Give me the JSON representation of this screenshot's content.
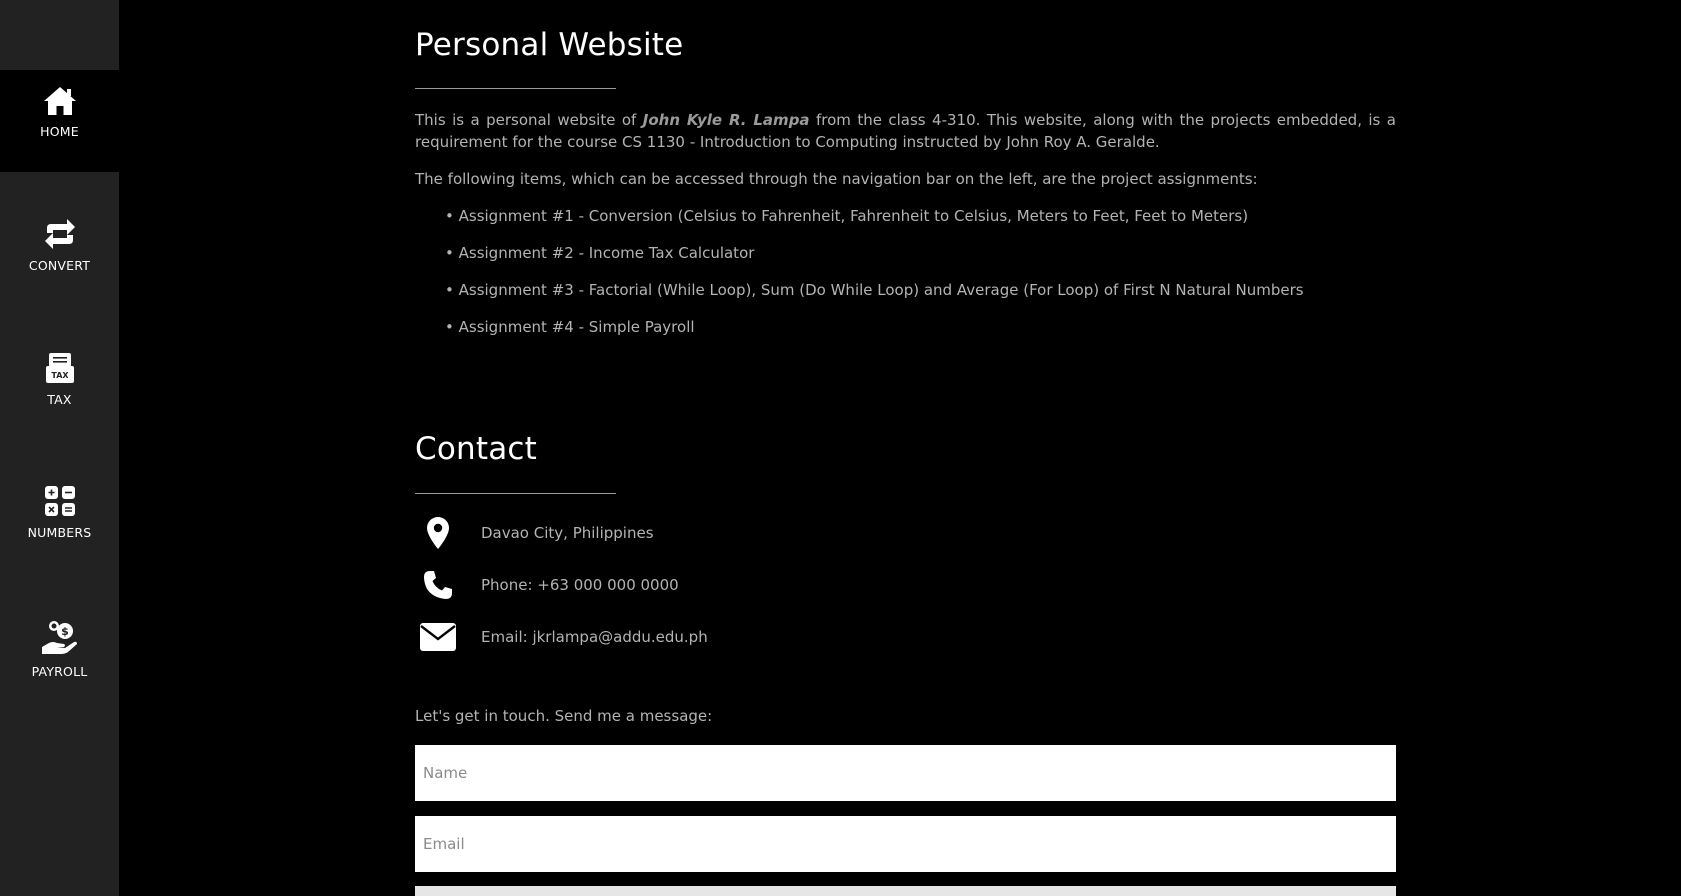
{
  "sidebar": {
    "items": [
      {
        "label": "HOME",
        "icon": "home-icon",
        "active": true
      },
      {
        "label": "CONVERT",
        "icon": "convert-icon",
        "active": false
      },
      {
        "label": "TAX",
        "icon": "tax-icon",
        "active": false
      },
      {
        "label": "NUMBERS",
        "icon": "calculator-icon",
        "active": false
      },
      {
        "label": "PAYROLL",
        "icon": "payroll-icon",
        "active": false
      }
    ]
  },
  "about": {
    "title": "Personal Website",
    "intro_before": "This is a personal website of ",
    "author": "John Kyle R. Lampa",
    "intro_after": " from the class 4-310. This website, along with the projects embedded, is a requirement for the course CS 1130 - Introduction to Computing instructed by John Roy A. Geralde.",
    "list_intro": "The following items, which can be accessed through the navigation bar on the left, are the project assignments:",
    "assignments": [
      "• Assignment #1 - Conversion (Celsius to Fahrenheit, Fahrenheit to Celsius, Meters to Feet, Feet to Meters)",
      "• Assignment #2 - Income Tax Calculator",
      "• Assignment #3 - Factorial (While Loop), Sum (Do While Loop) and Average (For Loop) of First N Natural Numbers",
      "• Assignment #4 - Simple Payroll"
    ]
  },
  "contact": {
    "title": "Contact",
    "location": "Davao City, Philippines",
    "phone": "Phone: +63 000 000 0000",
    "email": "Email: jkrlampa@addu.edu.ph",
    "message_intro": "Let's get in touch. Send me a message:",
    "name_placeholder": "Name",
    "email_placeholder": "Email"
  },
  "colors": {
    "sidebar_bg": "#222222",
    "active_bg": "#000000",
    "page_bg": "#000000",
    "text": "#b3b3b3",
    "heading": "#ffffff"
  }
}
